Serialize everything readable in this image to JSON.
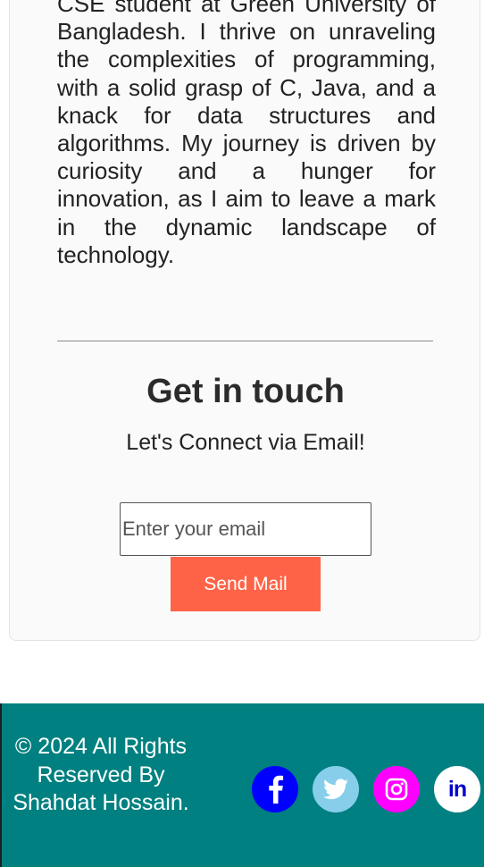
{
  "about": {
    "text": "CSE student at Green University of Bangladesh. I thrive on unraveling the complexities of programming, with a solid grasp of C, Java, and a knack for data structures and algorithms. My journey is driven by curiosity and a hunger for innovation, as I aim to leave a mark in the dynamic landscape of technology."
  },
  "contact": {
    "title": "Get in touch",
    "subtitle": "Let's Connect via Email!",
    "email_placeholder": "Enter your email",
    "email_value": "",
    "send_label": "Send Mail",
    "send_button_color": "#ff6347"
  },
  "footer": {
    "background_color": "#008080",
    "copyright": "© 2024 All Rights Reserved By Shahdat Hossain.",
    "social": [
      {
        "icon": "facebook-icon",
        "color": "#0000ff"
      },
      {
        "icon": "twitter-icon",
        "color": "#87ceeb"
      },
      {
        "icon": "instagram-icon",
        "color": "#ff00ff"
      },
      {
        "icon": "linkedin-icon",
        "color": "#ffffff",
        "glyph": "in"
      }
    ]
  }
}
